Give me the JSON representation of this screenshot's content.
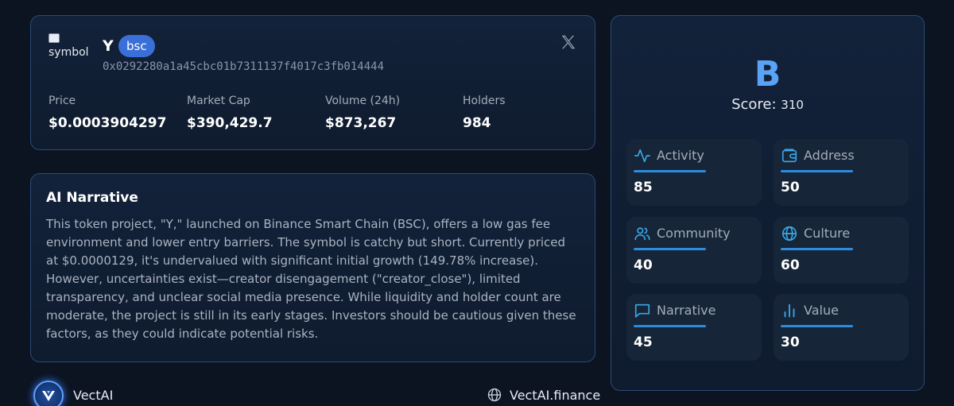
{
  "token": {
    "symbol_alt": "symbol",
    "name": "Y",
    "chain": "bsc",
    "address": "0x0292280a1a45cbc01b7311137f4017c3fb014444",
    "stats": {
      "price_label": "Price",
      "price_value": "$0.0003904297",
      "mcap_label": "Market Cap",
      "mcap_value": "$390,429.7",
      "volume_label": "Volume (24h)",
      "volume_value": "$873,267",
      "holders_label": "Holders",
      "holders_value": "984"
    }
  },
  "narrative": {
    "title": "AI Narrative",
    "text": "This token project, \"Y,\" launched on Binance Smart Chain (BSC), offers a low gas fee environment and lower entry barriers. The symbol is catchy but short. Currently priced at $0.0000129, it's undervalued with significant initial growth (149.78% increase). However, uncertainties exist—creator disengagement (\"creator_close\"), limited transparency, and unclear social media presence. While liquidity and holder count are moderate, the project is still in its early stages. Investors should be cautious given these factors, as they could indicate potential risks."
  },
  "footer": {
    "brand": "VectAI",
    "site": "VectAI.finance"
  },
  "score": {
    "grade": "B",
    "label": "Score:",
    "value": "310",
    "metrics": [
      {
        "label": "Activity",
        "value": "85",
        "icon": "activity-icon"
      },
      {
        "label": "Address",
        "value": "50",
        "icon": "wallet-icon"
      },
      {
        "label": "Community",
        "value": "40",
        "icon": "users-icon"
      },
      {
        "label": "Culture",
        "value": "60",
        "icon": "globe-icon"
      },
      {
        "label": "Narrative",
        "value": "45",
        "icon": "message-icon"
      },
      {
        "label": "Value",
        "value": "30",
        "icon": "bar-chart-icon"
      }
    ]
  },
  "colors": {
    "background": "#0c1422",
    "accent": "#5aa2f5",
    "badge": "#3a6fd8",
    "bar": "#2b8ce0"
  }
}
